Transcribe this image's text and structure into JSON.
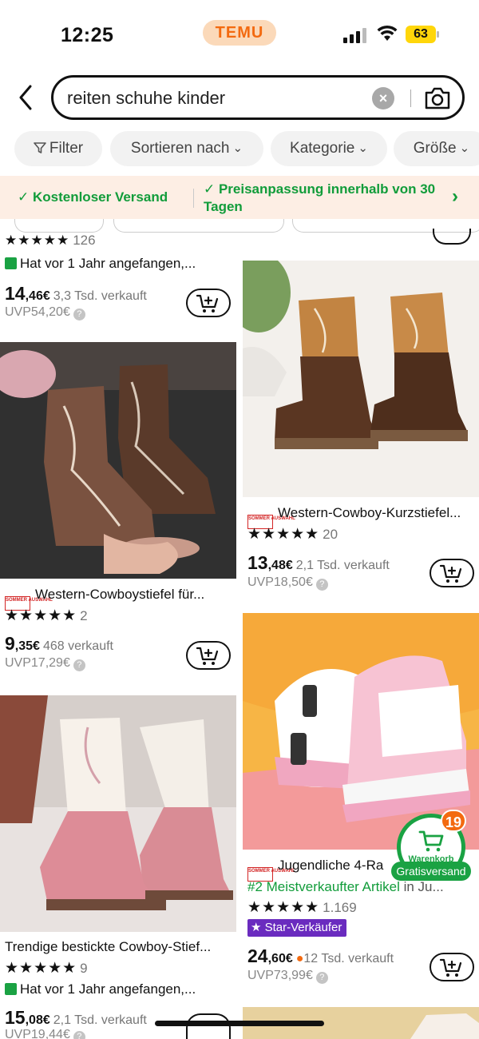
{
  "status_bar": {
    "time": "12:25",
    "brand": "TEMU",
    "battery": "63"
  },
  "search": {
    "query": "reiten schuhe kinder"
  },
  "chips": [
    {
      "label": "Filter"
    },
    {
      "label": "Sortieren nach"
    },
    {
      "label": "Kategorie"
    },
    {
      "label": "Größe"
    }
  ],
  "promo": {
    "free_shipping": "Kostenloser Versand",
    "price_match": "Preisanpassung innerhalb von 30 Tagen"
  },
  "products": [
    {
      "title": "",
      "rating_count": "126",
      "note": "Hat vor 1 Jahr angefangen,...",
      "price_int": "14",
      "price_dec": ",46€",
      "sold": "3,3 Tsd. verkauft",
      "uvp": "UVP54,20€"
    },
    {
      "title": "Western-Cowboystiefel für...",
      "rating_count": "2",
      "price_int": "9",
      "price_dec": ",35€",
      "sold": "468 verkauft",
      "uvp": "UVP17,29€"
    },
    {
      "title": "Trendige bestickte Cowboy-Stief...",
      "rating_count": "9",
      "note": "Hat vor 1 Jahr angefangen,...",
      "price_int": "15",
      "price_dec": ",08€",
      "sold": "2,1 Tsd. verkauft",
      "uvp": "UVP19,44€"
    },
    {
      "title": "Western-Cowboy-Kurzstiefel...",
      "rating_count": "20",
      "price_int": "13",
      "price_dec": ",48€",
      "sold": "2,1 Tsd. verkauft",
      "uvp": "UVP18,50€"
    },
    {
      "title": "Jugendliche 4-Ra",
      "rank": "#2 Meistverkaufter Artikel",
      "rank_rest": "in Ju...",
      "rating_count": "1.169",
      "star_seller": "Star-Verkäufer",
      "price_int": "24",
      "price_dec": ",60€",
      "sold": "12 Tsd. verkauft",
      "uvp": "UVP73,99€"
    }
  ],
  "sommer_badge": "SOMMER AUSWAHL",
  "floating_cart": {
    "count": "19",
    "label": "Warenkorb",
    "shipping": "Gratisversand"
  },
  "colors": {
    "accent_orange": "#f36a10",
    "green": "#1aa243",
    "purple": "#6a2bbf",
    "promo_bg": "#fdeee4"
  }
}
